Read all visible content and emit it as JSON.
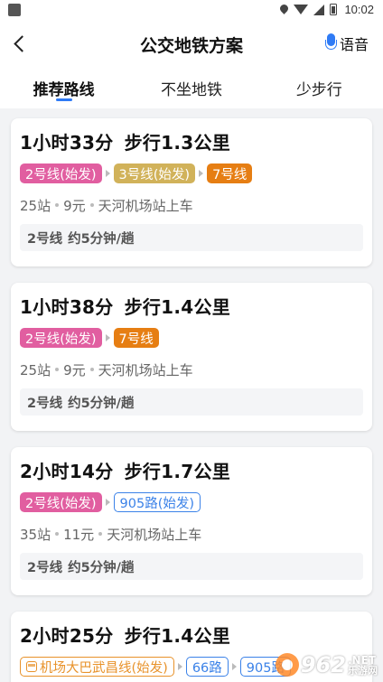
{
  "status_bar": {
    "time": "10:02"
  },
  "header": {
    "title": "公交地铁方案",
    "voice_label": "语音"
  },
  "tabs": [
    {
      "label": "推荐路线",
      "active": true
    },
    {
      "label": "不坐地铁",
      "active": false
    },
    {
      "label": "少步行",
      "active": false
    }
  ],
  "routes": [
    {
      "duration": "1小时33分",
      "walk": "步行1.3公里",
      "segments": [
        {
          "label": "2号线(始发)",
          "style": "filled",
          "color": "#e15ea0"
        },
        {
          "label": "3号线(始发)",
          "style": "filled",
          "color": "#d1b25a"
        },
        {
          "label": "7号线",
          "style": "filled",
          "color": "#e67e13"
        }
      ],
      "stops": "25站",
      "fare": "9元",
      "board": "天河机场站上车",
      "freq_line": "2号线",
      "freq_text": "约5分钟/趟"
    },
    {
      "duration": "1小时38分",
      "walk": "步行1.4公里",
      "segments": [
        {
          "label": "2号线(始发)",
          "style": "filled",
          "color": "#e15ea0"
        },
        {
          "label": "7号线",
          "style": "filled",
          "color": "#e67e13"
        }
      ],
      "stops": "25站",
      "fare": "9元",
      "board": "天河机场站上车",
      "freq_line": "2号线",
      "freq_text": "约5分钟/趟"
    },
    {
      "duration": "2小时14分",
      "walk": "步行1.7公里",
      "segments": [
        {
          "label": "2号线(始发)",
          "style": "filled",
          "color": "#e15ea0"
        },
        {
          "label": "905路(始发)",
          "style": "outline",
          "color": "#3b82e8"
        }
      ],
      "stops": "35站",
      "fare": "11元",
      "board": "天河机场站上车",
      "freq_line": "2号线",
      "freq_text": "约5分钟/趟"
    },
    {
      "duration": "2小时25分",
      "walk": "步行1.4公里",
      "segments": [
        {
          "label": "机场大巴武昌线(始发)",
          "style": "outline",
          "color": "#e8922a",
          "icon": "bus-icon"
        },
        {
          "label": "66路",
          "style": "outline",
          "color": "#3b82e8"
        },
        {
          "label": "905路",
          "style": "outline",
          "color": "#3b82e8"
        }
      ]
    }
  ],
  "watermark": {
    "number": "962",
    "net": ".NET",
    "site": "乐游网"
  }
}
